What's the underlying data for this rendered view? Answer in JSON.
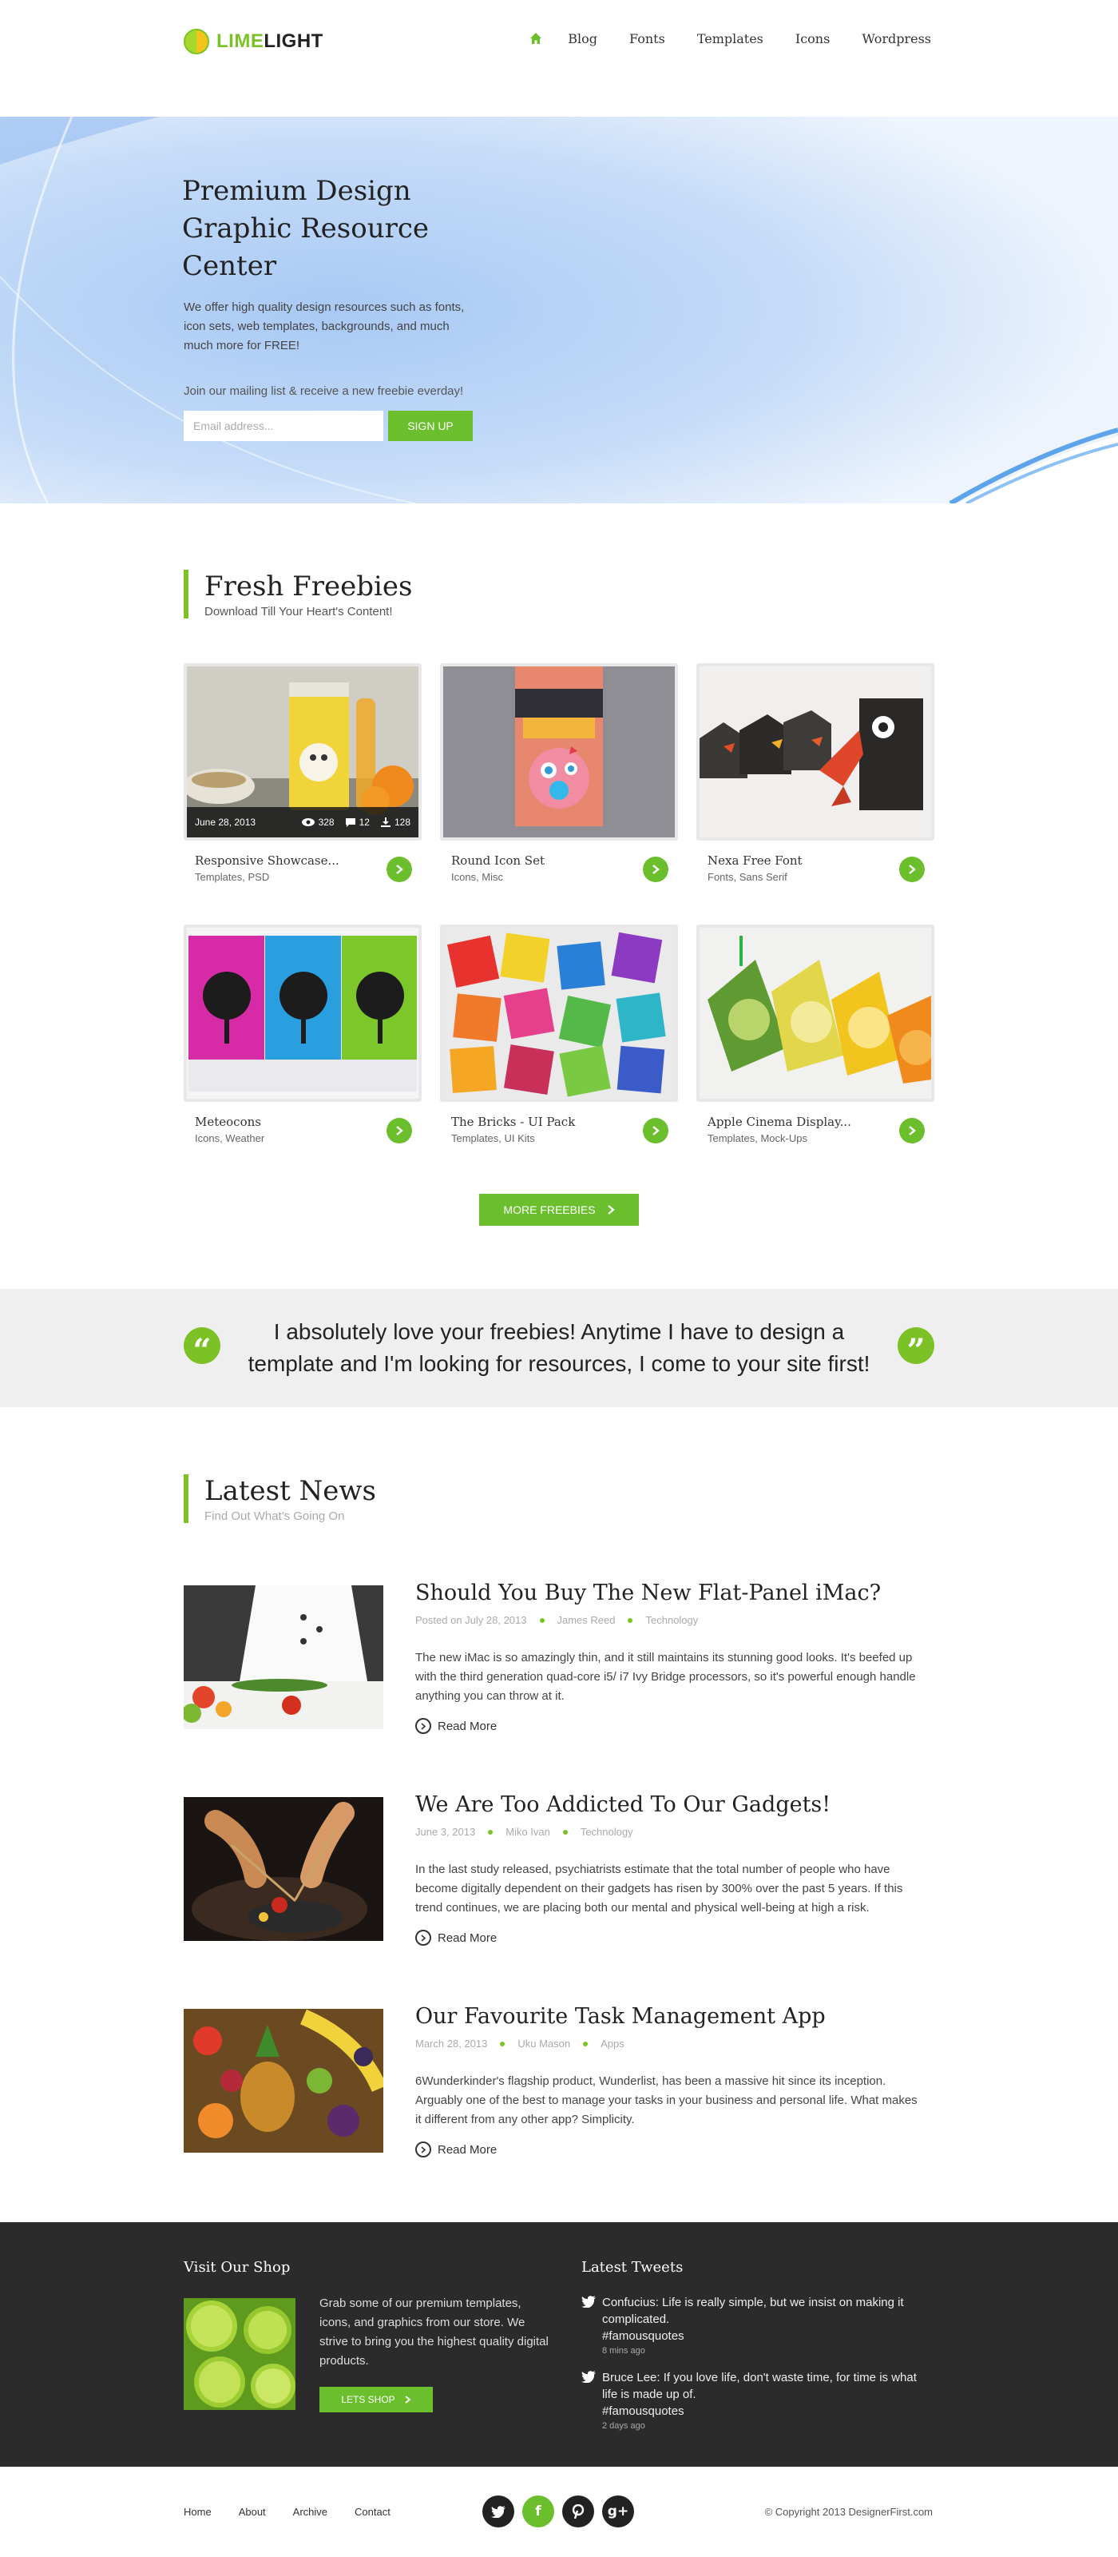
{
  "header": {
    "logo_lime": "LIME",
    "logo_light": "LIGHT",
    "nav": [
      "Blog",
      "Fonts",
      "Templates",
      "Icons",
      "Wordpress"
    ]
  },
  "hero": {
    "title": "Premium Design Graphic Resource Center",
    "subtitle": "We offer high quality design resources such as fonts, icon sets, web templates, backgrounds, and much much more for FREE!",
    "mailing": "Join our mailing list & receive a new freebie everday!",
    "email_placeholder": "Email address...",
    "signup": "SIGN UP"
  },
  "freebies": {
    "title": "Fresh Freebies",
    "subtitle": "Download Till Your Heart's Content!",
    "first_overlay": {
      "date": "June 28, 2013",
      "views": "328",
      "comments": "12",
      "downloads": "128"
    },
    "cards": [
      {
        "title": "Responsive Showcase...",
        "meta": "Templates, PSD"
      },
      {
        "title": "Round Icon Set",
        "meta": "Icons, Misc"
      },
      {
        "title": "Nexa Free Font",
        "meta": "Fonts, Sans Serif"
      },
      {
        "title": "Meteocons",
        "meta": "Icons, Weather"
      },
      {
        "title": "The Bricks - UI Pack",
        "meta": "Templates, UI Kits"
      },
      {
        "title": "Apple Cinema Display...",
        "meta": "Templates, Mock-Ups"
      }
    ],
    "more": "MORE FREEBIES"
  },
  "quote": {
    "open": "“",
    "close": "”",
    "text": "I absolutely love your freebies! Anytime I have to design a template and I'm looking for resources, I come to your site first!"
  },
  "news": {
    "title": "Latest News",
    "subtitle": "Find Out What's Going On",
    "read_more": "Read More",
    "items": [
      {
        "title": "Should You Buy The New Flat-Panel iMac?",
        "date": "Posted on July 28, 2013",
        "author": "James Reed",
        "category": "Technology",
        "body": "The new iMac is so amazingly thin, and it still maintains its stunning good looks. It's beefed up with the third generation quad-core i5/ i7 Ivy Bridge processors, so it's powerful enough handle anything you can throw at it."
      },
      {
        "title": "We Are Too Addicted To Our Gadgets!",
        "date": "June 3, 2013",
        "author": "Miko Ivan",
        "category": "Technology",
        "body": "In the last study released, psychiatrists estimate that the total number of people who have become digitally dependent on their gadgets has risen by 300% over the past 5 years. If this trend continues, we are placing both our mental and physical well-being at high a risk."
      },
      {
        "title": "Our Favourite Task Management App",
        "date": "March 28, 2013",
        "author": "Uku Mason",
        "category": "Apps",
        "body": "6Wunderkinder's flagship product, Wunderlist, has been a massive hit since its inception. Arguably one of the best to manage your tasks in your business and personal life. What makes it different from any other app? Simplicity."
      }
    ]
  },
  "footer": {
    "shop_title": "Visit Our Shop",
    "shop_text": "Grab some of our premium templates, icons, and graphics from our store. We strive to bring you the highest quality digital products.",
    "shop_btn": "LETS SHOP",
    "tweets_title": "Latest Tweets",
    "tweets": [
      {
        "text": "Confucius: Life is really simple, but we insist on making it complicated.",
        "tag": "#famousquotes",
        "time": "8 mins ago"
      },
      {
        "text": "Bruce Lee: If you love life, don't waste time, for time is what life is made up of.",
        "tag": "#famousquotes",
        "time": "2 days ago"
      }
    ]
  },
  "bottom": {
    "links": [
      "Home",
      "About",
      "Archive",
      "Contact"
    ],
    "socials": [
      "twitter-icon",
      "facebook-icon",
      "pinterest-icon",
      "google-plus-icon"
    ],
    "copyright": "© Copyright 2013 DesignerFirst.com"
  },
  "colors": {
    "accent": "#6bbf2d",
    "dark": "#2b2b2b",
    "quote_bg": "#efefef"
  }
}
